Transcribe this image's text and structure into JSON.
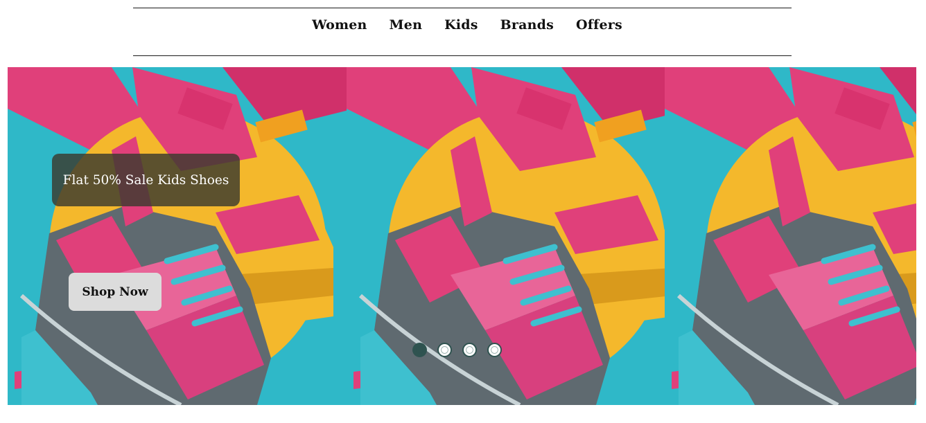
{
  "nav": {
    "items": [
      {
        "label": "Women"
      },
      {
        "label": "Men"
      },
      {
        "label": "Kids"
      },
      {
        "label": "Brands"
      },
      {
        "label": "Offers"
      }
    ]
  },
  "hero": {
    "caption": "Flat 50% Sale Kids Shoes",
    "cta_label": "Shop Now",
    "slide_count": 4,
    "active_slide": 1
  },
  "colors": {
    "accent": "#2f5350",
    "caption_bg": "#3a3a2e",
    "cta_bg": "#dcdcdc",
    "pink": "#e0407a",
    "teal": "#2fb8c8",
    "yellow": "#f4b82c",
    "gray_shoe": "#5f6a70"
  }
}
